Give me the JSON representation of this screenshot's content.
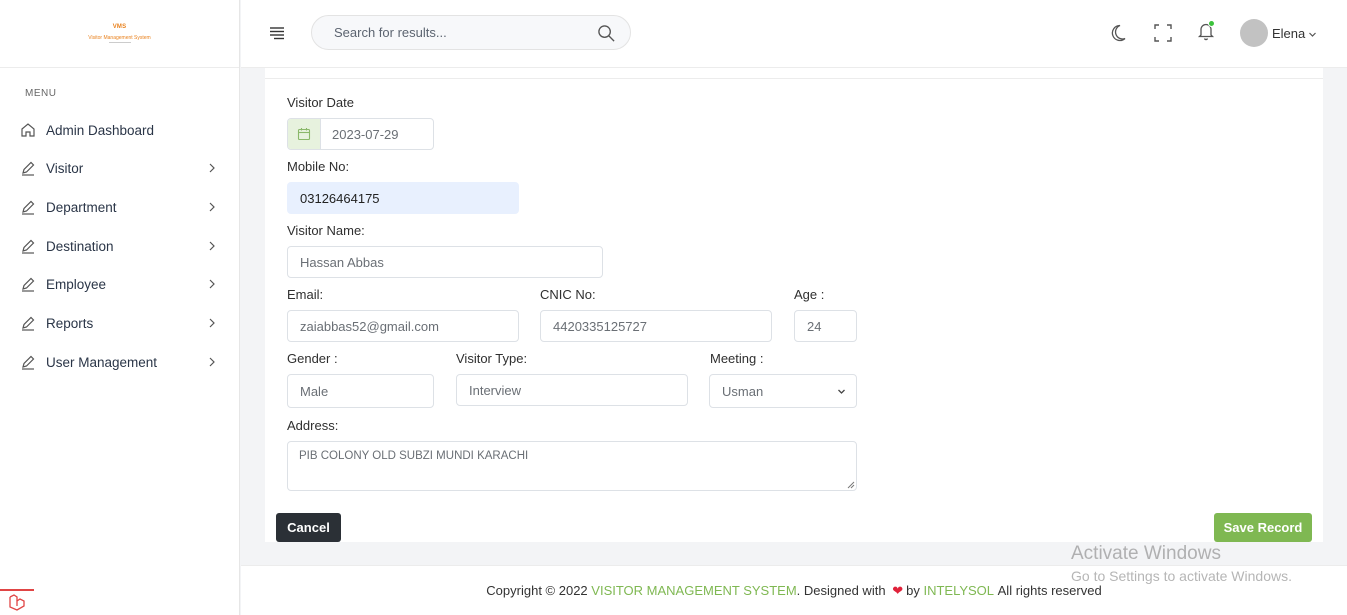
{
  "colors": {
    "accent_green": "#7fb852",
    "dark_button": "#2b3036",
    "logo_orange": "#e9811d",
    "heart_red": "#e0223a"
  },
  "logo": {
    "line1": "VMS",
    "line2": "Visitor Management System"
  },
  "sidebar": {
    "menu_title": "MENU",
    "items": [
      {
        "label": "Admin Dashboard",
        "icon": "home-icon"
      },
      {
        "label": "Visitor",
        "icon": "edit-icon"
      },
      {
        "label": "Department",
        "icon": "edit-icon"
      },
      {
        "label": "Destination",
        "icon": "edit-icon"
      },
      {
        "label": "Employee",
        "icon": "edit-icon"
      },
      {
        "label": "Reports",
        "icon": "edit-icon"
      },
      {
        "label": "User Management",
        "icon": "edit-icon"
      }
    ]
  },
  "topbar": {
    "search_placeholder": "Search for results...",
    "user_name": "Elena"
  },
  "form": {
    "visitor_date": {
      "label": "Visitor Date",
      "value": "2023-07-29"
    },
    "mobile": {
      "label": "Mobile No:",
      "value": "03126464175"
    },
    "visitor_name": {
      "label": "Visitor Name:",
      "value": "Hassan Abbas"
    },
    "email": {
      "label": "Email:",
      "value": "zaiabbas52@gmail.com"
    },
    "cnic": {
      "label": "CNIC No:",
      "value": "4420335125727"
    },
    "age": {
      "label": "Age :",
      "value": "24"
    },
    "gender": {
      "label": "Gender :",
      "value": "Male"
    },
    "visitor_type": {
      "label": "Visitor Type:",
      "value": "Interview"
    },
    "meeting": {
      "label": "Meeting :",
      "value": "Usman"
    },
    "address": {
      "label": "Address:",
      "value": "PIB COLONY OLD SUBZI MUNDI KARACHI"
    },
    "cancel_label": "Cancel",
    "save_label": "Save Record"
  },
  "footer": {
    "prefix": "Copyright © 2022",
    "system_name": "VISITOR MANAGEMENT SYSTEM",
    "designed_with": ". Designed with",
    "by": "by",
    "company": "INTELYSOL",
    "suffix": "All rights reserved"
  },
  "watermark": {
    "line1": "Activate Windows",
    "line2": "Go to Settings to activate Windows."
  }
}
